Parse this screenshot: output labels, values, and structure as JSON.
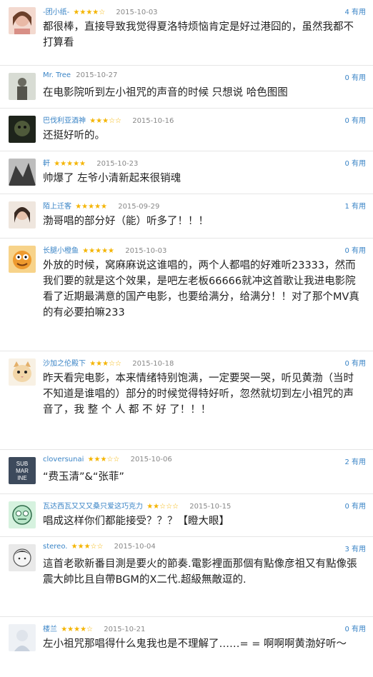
{
  "comments": [
    {
      "user": "-团小纸-",
      "stars": "★★★★☆",
      "date": "2015-10-03",
      "useful": "4 有用",
      "text": "都很棒，直接导致我觉得夏洛特烦恼肯定是好过港囧的，虽然我都不打算看",
      "avatar_icon": "girl-avatar-icon",
      "avatar_color": "#e9b9a6"
    },
    {
      "user": "Mr. Tree",
      "stars": "",
      "date": "2015-10-27",
      "useful": "0 有用",
      "text": "在电影院听到左小祖咒的声音的时候 只想说 哈色图图",
      "avatar_icon": "man-avatar-icon",
      "avatar_color": "#7a7a70"
    },
    {
      "user": "巴伐利亚酒神",
      "stars": "★★★☆☆",
      "date": "2015-10-16",
      "useful": "0 有用",
      "text": "还挺好听的。",
      "avatar_icon": "dark-avatar-icon",
      "avatar_color": "#2f3a2a"
    },
    {
      "user": "軒",
      "stars": "★★★★★",
      "date": "2015-10-23",
      "useful": "0 有用",
      "text": "帅爆了 左爷小清新起来很销魂",
      "avatar_icon": "bw-avatar-icon",
      "avatar_color": "#5a5a5a"
    },
    {
      "user": "陌上迁客",
      "stars": "★★★★★",
      "date": "2015-09-29",
      "useful": "1 有用",
      "text": "渤哥唱的部分好（能）听多了！！！",
      "avatar_icon": "girl2-avatar-icon",
      "avatar_color": "#c8a58f"
    },
    {
      "user": "长腿小橙鱼",
      "stars": "★★★★★",
      "date": "2015-10-03",
      "useful": "0 有用",
      "text": "外放的时候，窝麻麻说这谁唱的，两个人都唱的好难听23333，然而我们要的就是这个效果，是吧左老板66666就冲这首歌让我进电影院看了近期最满意的国产电影，也要给满分，给满分！！对了那个MV真的有必要拍嘛233",
      "avatar_icon": "cartoon-avatar-icon",
      "avatar_color": "#e8a33a"
    },
    {
      "user": "沙加之伦殿下",
      "stars": "★★★☆☆",
      "date": "2015-10-18",
      "useful": "0 有用",
      "text": "昨天看完电影，本来情绪特别饱满，一定要哭一哭，听见黄渤（当时不知道是谁唱的）部分的时候觉得特好听，忽然就切到左小祖咒的声音了，我 整 个 人 都 不 好 了！！！",
      "avatar_icon": "cat-avatar-icon",
      "avatar_color": "#e9c48a"
    },
    {
      "user": "cloversunai",
      "stars": "★★★☆☆",
      "date": "2015-10-06",
      "useful": "2 有用",
      "text": "“费玉清”&“张菲”",
      "avatar_icon": "submarine-avatar-icon",
      "avatar_color": "#3d4a5c",
      "avatar_text": [
        "SUB",
        "MAR",
        "INE"
      ]
    },
    {
      "user": "瓦达西瓦又又又桑只爱这巧克力",
      "stars": "★★☆☆☆",
      "date": "2015-10-15",
      "useful": "0 有用",
      "text": "唱成这样你们都能接受？？？【瞪大眼】",
      "avatar_icon": "cartoon-face-avatar-icon",
      "avatar_color": "#b9e6c9"
    },
    {
      "user": "stereo.",
      "stars": "★★★☆☆",
      "date": "2015-10-04",
      "useful": "3 有用",
      "text": "這首老歌新番目測是要火的節奏.電影裡面那個有點像彦祖又有點像張震大帥比且自帶BGM的X二代.超級無敵逗的.",
      "avatar_icon": "sketch-avatar-icon",
      "avatar_color": "#9a9a9a"
    },
    {
      "user": "楼兰",
      "stars": "★★★★☆",
      "date": "2015-10-21",
      "useful": "0 有用",
      "text": "左小祖咒那唱得什么鬼我也是不理解了……= = 啊啊啊黄渤好听～",
      "avatar_icon": "light-avatar-icon",
      "avatar_color": "#d9dfe8"
    }
  ]
}
